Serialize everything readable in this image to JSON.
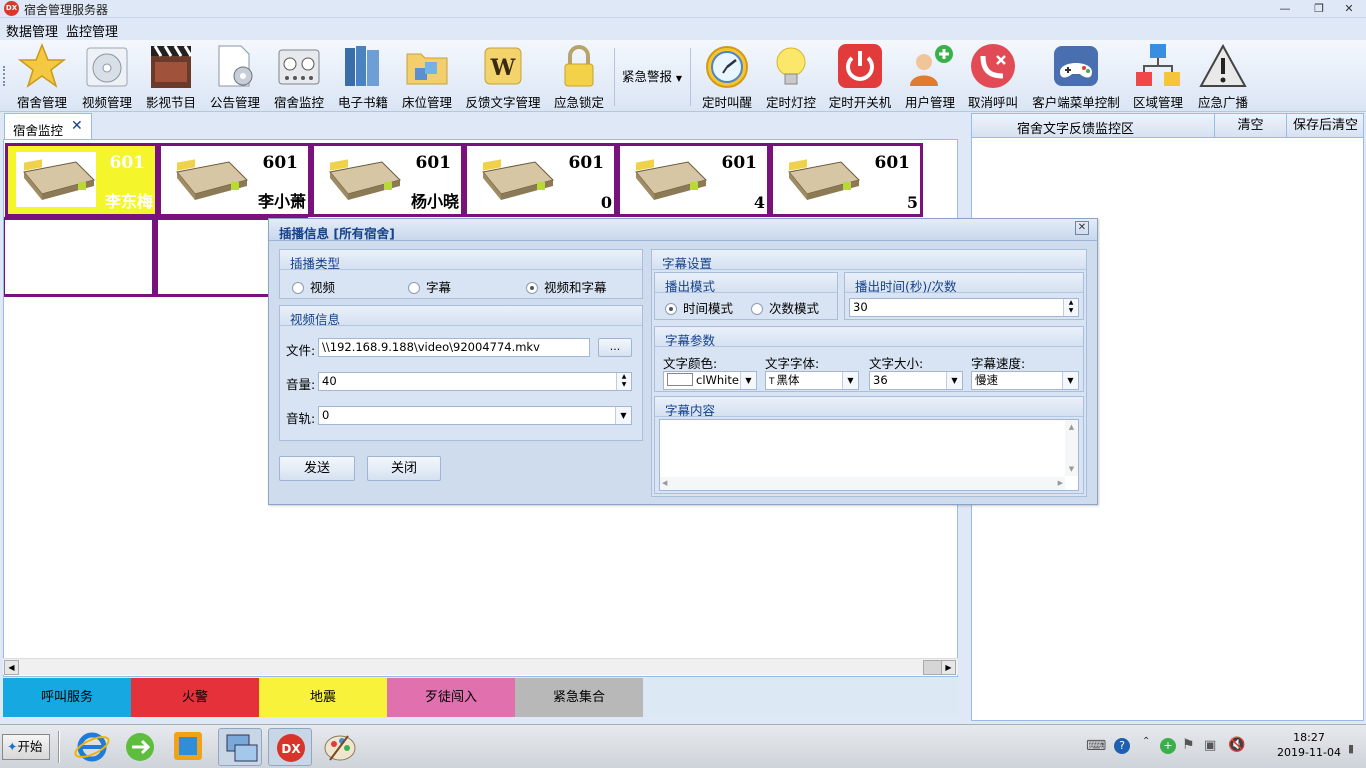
{
  "window": {
    "title": "宿舍管理服务器",
    "app_icon_text": "DX"
  },
  "menu": [
    "数据管理",
    "监控管理"
  ],
  "toolbar": [
    {
      "label": "宿舍管理",
      "icon": "star-icon"
    },
    {
      "label": "视频管理",
      "icon": "disc-icon"
    },
    {
      "label": "影视节目",
      "icon": "clapperboard-icon"
    },
    {
      "label": "公告管理",
      "icon": "document-gear-icon"
    },
    {
      "label": "宿舍监控",
      "icon": "control-panel-icon"
    },
    {
      "label": "电子书籍",
      "icon": "books-icon"
    },
    {
      "label": "床位管理",
      "icon": "folder-blocks-icon"
    },
    {
      "label": "反馈文字管理",
      "icon": "letter-tile-icon"
    },
    {
      "label": "应急锁定",
      "icon": "padlock-icon"
    },
    {
      "label": "紧急警报",
      "icon": "dropdown-icon"
    },
    {
      "label": "定时叫醒",
      "icon": "clock-icon"
    },
    {
      "label": "定时灯控",
      "icon": "lightbulb-icon"
    },
    {
      "label": "定时开关机",
      "icon": "power-icon"
    },
    {
      "label": "用户管理",
      "icon": "user-add-icon"
    },
    {
      "label": "取消呼叫",
      "icon": "phone-cancel-icon"
    },
    {
      "label": "客户端菜单控制",
      "icon": "gamepad-icon"
    },
    {
      "label": "区域管理",
      "icon": "network-blocks-icon"
    },
    {
      "label": "应急广播",
      "icon": "warning-icon"
    }
  ],
  "left_tab": {
    "label": "宿舍监控",
    "close": "✕"
  },
  "rooms": [
    {
      "number": "601",
      "name": "李东梅",
      "active": true
    },
    {
      "number": "601",
      "name": "李小萧",
      "active": false
    },
    {
      "number": "601",
      "name": "杨小晓",
      "active": false
    },
    {
      "number": "601",
      "name": "0",
      "active": false
    },
    {
      "number": "601",
      "name": "4",
      "active": false
    },
    {
      "number": "601",
      "name": "5",
      "active": false
    }
  ],
  "emergency_buttons": [
    {
      "label": "呼叫服务",
      "color": "#16a8e0"
    },
    {
      "label": "火警",
      "color": "#e5323a"
    },
    {
      "label": "地震",
      "color": "#f8f23a"
    },
    {
      "label": "歹徒闯入",
      "color": "#e070ae"
    },
    {
      "label": "紧急集合",
      "color": "#b8b8b8"
    }
  ],
  "right_panel": {
    "title": "宿舍文字反馈监控区",
    "clear": "清空",
    "save_clear": "保存后清空"
  },
  "dialog": {
    "title": "插播信息 [所有宿舍]",
    "play_type": {
      "header": "插播类型",
      "options": [
        "视频",
        "字幕",
        "视频和字幕"
      ],
      "selected": "视频和字幕"
    },
    "video_info": {
      "header": "视频信息",
      "file_label": "文件:",
      "file_value": "\\\\192.168.9.188\\video\\92004774.mkv",
      "browse": "...",
      "volume_label": "音量:",
      "volume_value": "40",
      "track_label": "音轨:",
      "track_value": "0"
    },
    "send": "发送",
    "close": "关闭",
    "subtitle_settings": {
      "header": "字幕设置",
      "mode_header": "播出模式",
      "modes": [
        "时间模式",
        "次数模式"
      ],
      "mode_selected": "时间模式",
      "duration_header": "播出时间(秒)/次数",
      "duration_value": "30",
      "params_header": "字幕参数",
      "color_label": "文字颜色:",
      "color_value": "clWhite",
      "font_label": "文字字体:",
      "font_value": "黑体",
      "size_label": "文字大小:",
      "size_value": "36",
      "speed_label": "字幕速度:",
      "speed_value": "慢速",
      "content_header": "字幕内容",
      "content_value": ""
    }
  },
  "taskbar": {
    "start": "开始",
    "clock_time": "18:27",
    "clock_date": "2019-11-04"
  }
}
